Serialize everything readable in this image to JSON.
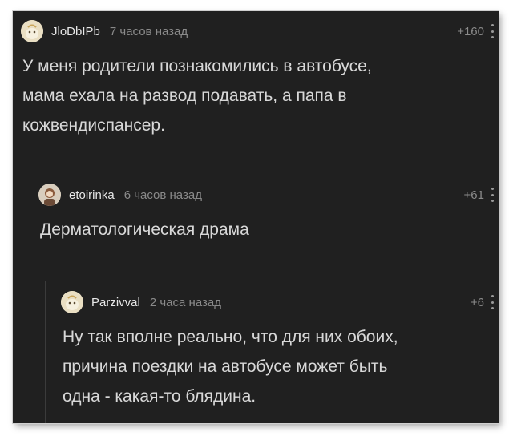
{
  "comments": [
    {
      "username": "JloDbIPb",
      "time": "7 часов назад",
      "rating": "+160",
      "lines": [
        "У меня родители познакомились в автобусе,",
        "мама ехала на развод подавать, а папа в",
        "кожвендиспансер."
      ],
      "avatar_icon": "default-avatar-icon"
    },
    {
      "username": "etoirinka",
      "time": "6 часов назад",
      "rating": "+61",
      "lines": [
        "Дерматологическая драма"
      ],
      "avatar_icon": "user-avatar-icon"
    },
    {
      "username": "Parzivval",
      "time": "2 часа назад",
      "rating": "+6",
      "lines": [
        "Ну так вполне реально, что для них обоих,",
        "причина поездки на автобусе может быть",
        "одна - какая-то блядина."
      ],
      "avatar_icon": "default-avatar-icon"
    }
  ],
  "colors": {
    "background": "#202020",
    "text": "#d8d8d8",
    "meta": "#8a8a8a",
    "username": "#e7e7e7"
  }
}
